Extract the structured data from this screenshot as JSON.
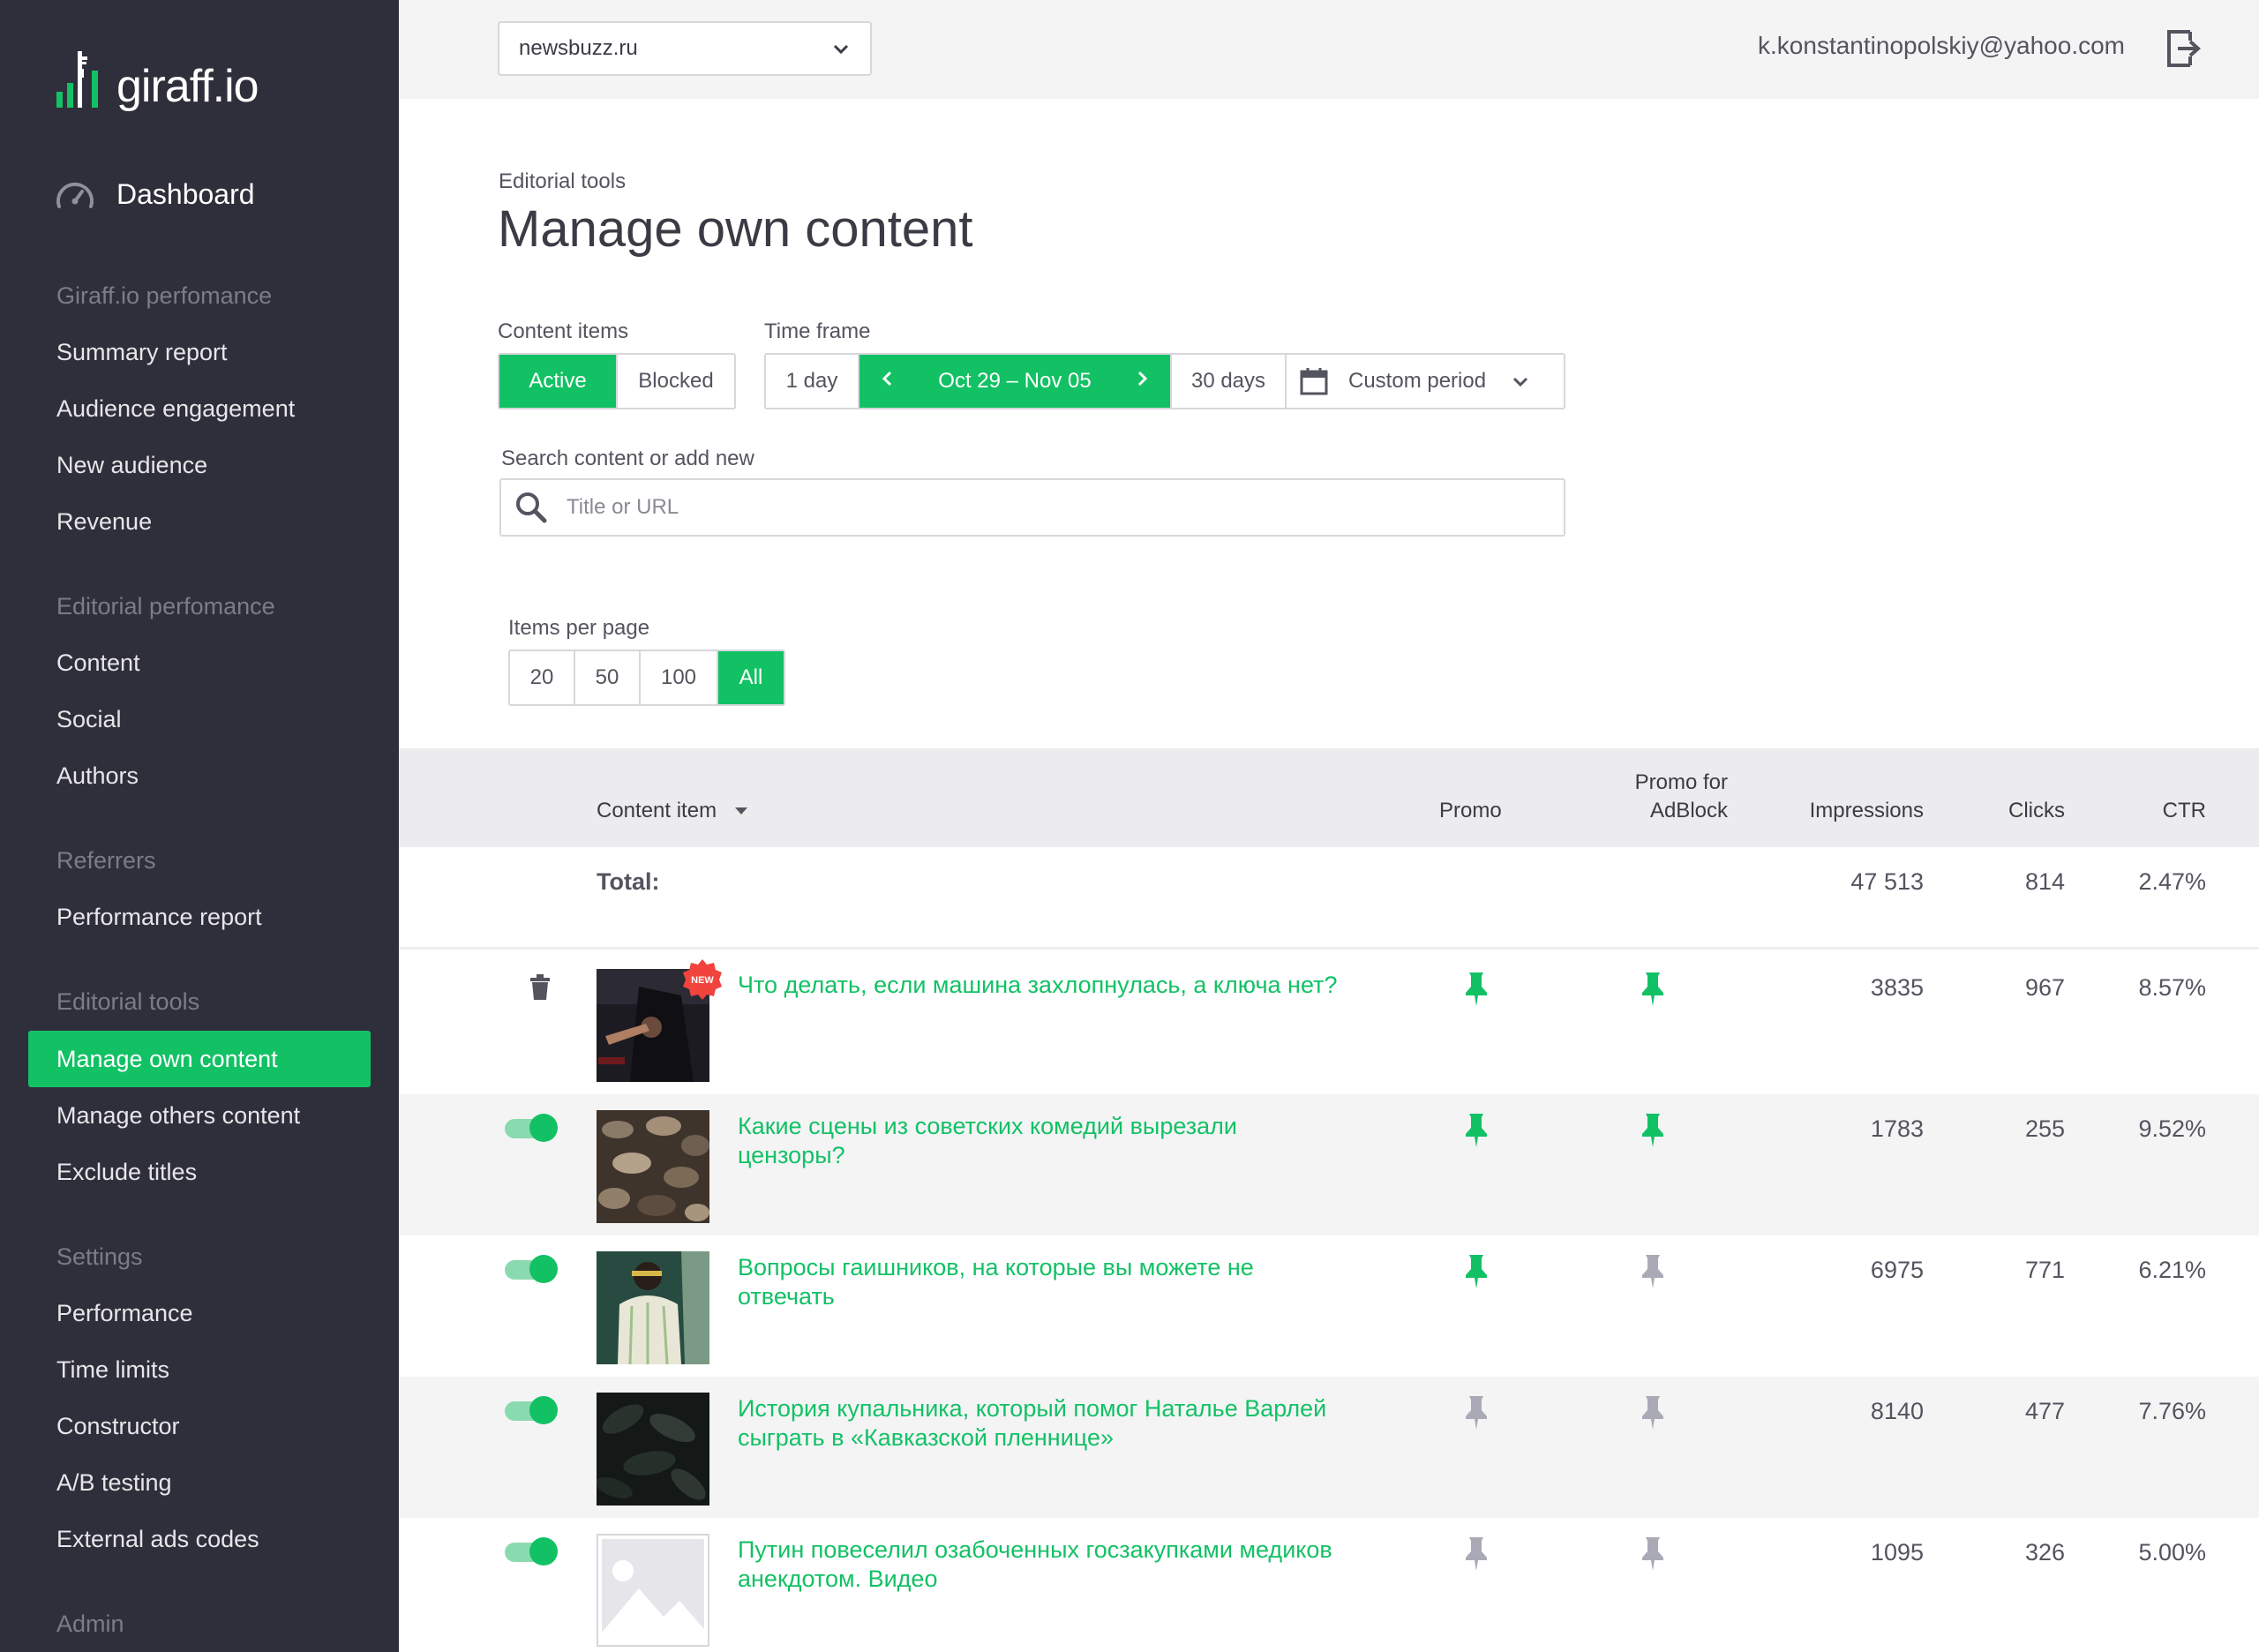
{
  "brand": {
    "name": "giraff.io"
  },
  "sidebar": {
    "dashboard": "Dashboard",
    "sections": [
      {
        "title": "Giraff.io perfomance",
        "items": [
          "Summary report",
          "Audience engagement",
          "New audience",
          "Revenue"
        ]
      },
      {
        "title": "Editorial perfomance",
        "items": [
          "Content",
          "Social",
          "Authors"
        ]
      },
      {
        "title": "Referrers",
        "items": [
          "Performance report"
        ]
      },
      {
        "title": "Editorial tools",
        "items": [
          "Manage own content",
          "Manage others content",
          "Exclude titles"
        ]
      },
      {
        "title": "Settings",
        "items": [
          "Performance",
          "Time limits",
          "Constructor",
          "A/B testing",
          "External ads codes"
        ]
      },
      {
        "title": "Admin",
        "items": []
      }
    ],
    "active_item": "Manage own content"
  },
  "topbar": {
    "site": "newsbuzz.ru",
    "user_email": "k.konstantinopolskiy@yahoo.com"
  },
  "page": {
    "breadcrumb": "Editorial tools",
    "title": "Manage own content"
  },
  "filters": {
    "content_items_label": "Content items",
    "content_items": [
      "Active",
      "Blocked"
    ],
    "content_items_selected": "Active",
    "time_frame_label": "Time frame",
    "time_frame": {
      "one_day": "1 day",
      "range": "Oct 29 – Nov 05",
      "thirty_days": "30 days",
      "custom": "Custom period"
    },
    "search_label": "Search content or add new",
    "search_placeholder": "Title or URL",
    "per_page_label": "Items per page",
    "per_page": [
      "20",
      "50",
      "100",
      "All"
    ],
    "per_page_selected": "All"
  },
  "table": {
    "headers": {
      "content_item": "Content item",
      "promo": "Promo",
      "promo_adblock_1": "Promo for",
      "promo_adblock_2": "AdBlock",
      "impressions": "Impressions",
      "clicks": "Clicks",
      "ctr": "CTR"
    },
    "total": {
      "label": "Total:",
      "impressions": "47 513",
      "clicks": "814",
      "ctr": "2.47%"
    },
    "rows": [
      {
        "title": "Что делать, если машина захлопнулась, а ключа нет?",
        "promo": true,
        "promo_adblock": true,
        "impressions": "3835",
        "clicks": "967",
        "ctr": "8.57%",
        "badge": "NEW",
        "control": "trash"
      },
      {
        "title": "Какие сцены из советских комедий вырезали цензоры?",
        "promo": true,
        "promo_adblock": true,
        "impressions": "1783",
        "clicks": "255",
        "ctr": "9.52%",
        "control": "toggle"
      },
      {
        "title": "Вопросы гаишников, на которые вы можете не отвечать",
        "promo": true,
        "promo_adblock": false,
        "impressions": "6975",
        "clicks": "771",
        "ctr": "6.21%",
        "control": "toggle"
      },
      {
        "title": "История купальника, который помог Наталье Варлей сыграть в «Кавказской пленнице»",
        "promo": false,
        "promo_adblock": false,
        "impressions": "8140",
        "clicks": "477",
        "ctr": "7.76%",
        "control": "toggle"
      },
      {
        "title": "Путин повеселил озабоченных госзакупками медиков анекдотом. Видео",
        "promo": false,
        "promo_adblock": false,
        "impressions": "1095",
        "clicks": "326",
        "ctr": "5.00%",
        "control": "toggle"
      }
    ]
  },
  "colors": {
    "accent": "#13c165",
    "sidebar_bg": "#2f2f3b",
    "pin_inactive": "#a9aab6"
  }
}
